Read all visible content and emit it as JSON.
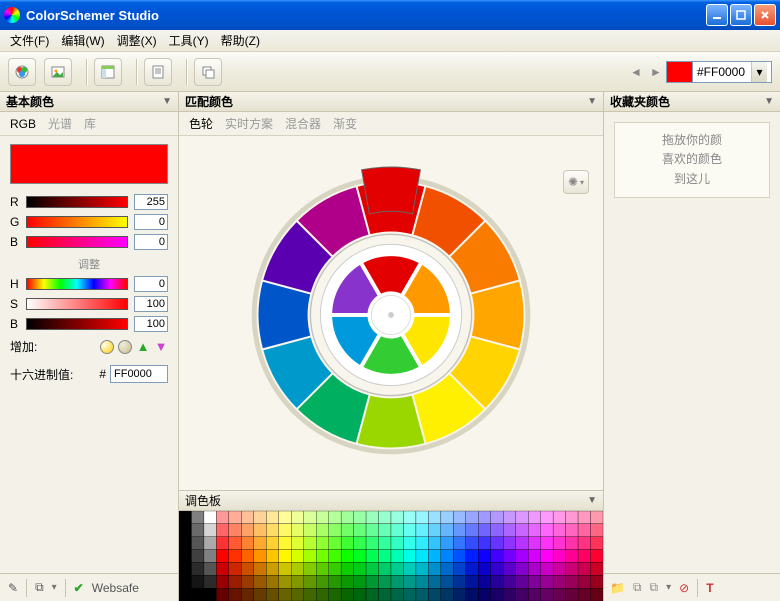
{
  "app": {
    "title": "ColorSchemer Studio"
  },
  "menu": {
    "file": "文件(F)",
    "edit": "编辑(W)",
    "adjust": "调整(X)",
    "tools": "工具(Y)",
    "help": "帮助(Z)"
  },
  "toolbar": {
    "hex_value": "#FF0000"
  },
  "panels": {
    "left_title": "基本颜色",
    "center_title": "匹配颜色",
    "right_title": "收藏夹颜色"
  },
  "left": {
    "tabs": {
      "rgb": "RGB",
      "spectrum": "光谱",
      "hue": "库"
    },
    "rgb": {
      "r_label": "R",
      "g_label": "G",
      "b_label": "B",
      "r": "255",
      "g": "0",
      "b": "0"
    },
    "hsb_divider": "调整",
    "hsb": {
      "h_label": "H",
      "s_label": "S",
      "b_label": "B",
      "h": "0",
      "s": "100",
      "b": "100"
    },
    "append_label": "增加:",
    "hex_label": "十六进制值:",
    "hex_prefix": "#",
    "hex_value": "FF0000",
    "footer": {
      "websafe": "Websafe"
    }
  },
  "center": {
    "tabs": {
      "wheel": "色轮",
      "live": "实时方案",
      "mixer": "混合器",
      "grad": "渐变"
    },
    "palette_label": "调色板"
  },
  "right": {
    "drop1": "拖放你的颜",
    "drop2": "喜欢的颜色",
    "drop3": "到这儿"
  },
  "colors": {
    "preview": "#FF0000",
    "r_grad": "linear-gradient(to right,#000000,#ff0000)",
    "g_grad": "linear-gradient(to right,#ff0000,#ffff00)",
    "b_grad": "linear-gradient(to right,#ff0000,#ff00ff)",
    "h_grad": "linear-gradient(to right,red,yellow,lime,cyan,blue,magenta,red)",
    "s_grad": "linear-gradient(to right,#ffffff,#ff0000)",
    "br_grad": "linear-gradient(to right,#000000,#ff0000)"
  }
}
